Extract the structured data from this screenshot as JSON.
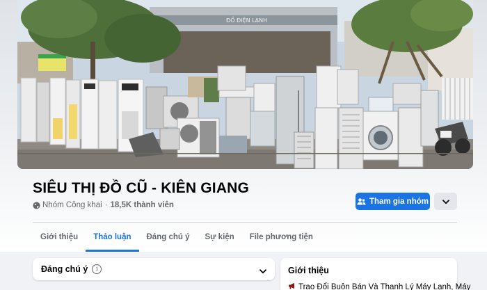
{
  "group": {
    "name": "SIÊU THỊ ĐỒ CŨ - KIÊN GIANG",
    "privacy": "Nhóm Công khai",
    "separator": "·",
    "members": "18,5K thành viên"
  },
  "actions": {
    "join_label": "Tham gia nhóm"
  },
  "tabs": [
    {
      "label": "Giới thiệu",
      "active": false
    },
    {
      "label": "Thảo luận",
      "active": true
    },
    {
      "label": "Đáng chú ý",
      "active": false
    },
    {
      "label": "Sự kiện",
      "active": false
    },
    {
      "label": "File phương tiện",
      "active": false
    }
  ],
  "featured": {
    "title": "Đáng chú ý",
    "info_glyph": "i"
  },
  "about": {
    "title": "Giới thiệu",
    "desc": "Trao Đổi Buôn Bán Và Thanh Lý Máy Lạnh, Máy"
  },
  "cover": {
    "sign_text": "ĐỒ ĐIỆN LẠNH"
  },
  "colors": {
    "accent": "#1b74e4",
    "secondary_text": "#65676b",
    "background": "#f0f2f5"
  },
  "icons": [
    "globe-icon",
    "people-icon",
    "chevron-down-icon",
    "info-icon",
    "megaphone-icon"
  ]
}
